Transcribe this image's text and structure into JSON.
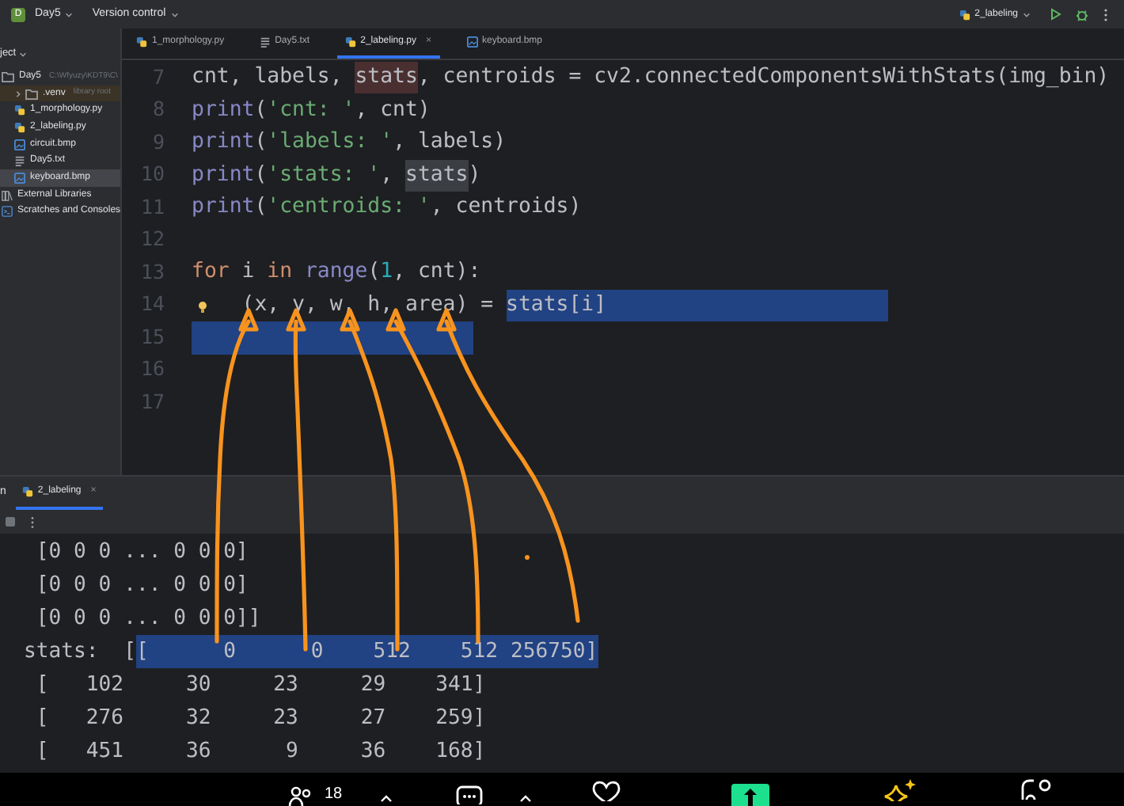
{
  "title_bar": {
    "project_badge": "D",
    "project": "Day5",
    "vcs": "Version control",
    "run_config": "2_labeling"
  },
  "project_panel": {
    "header": "ject",
    "items": [
      {
        "label": "Day5",
        "hint": "C:\\Wfyuzy\\KDT9\\C\\",
        "kind": "folder",
        "expanded": true,
        "excluded": false,
        "selected": false,
        "children": [
          {
            "label": ".venv",
            "hint": "library root",
            "kind": "folder",
            "expanded": false,
            "excluded": true,
            "selected": false
          },
          {
            "label": "1_morphology.py",
            "kind": "python",
            "excluded": false,
            "selected": false
          },
          {
            "label": "2_labeling.py",
            "kind": "python",
            "excluded": false,
            "selected": false
          },
          {
            "label": "circuit.bmp",
            "kind": "image",
            "excluded": false,
            "selected": false
          },
          {
            "label": "Day5.txt",
            "kind": "text",
            "excluded": false,
            "selected": false
          },
          {
            "label": "keyboard.bmp",
            "kind": "image",
            "excluded": false,
            "selected": true
          }
        ]
      },
      {
        "label": "External Libraries",
        "kind": "library",
        "excluded": false,
        "selected": false
      },
      {
        "label": "Scratches and Consoles",
        "kind": "scratches",
        "excluded": false,
        "selected": false
      }
    ]
  },
  "editor_tabs": [
    {
      "label": "1_morphology.py",
      "kind": "python",
      "selected": false
    },
    {
      "label": "Day5.txt",
      "kind": "text",
      "selected": false
    },
    {
      "label": "2_labeling.py",
      "kind": "python",
      "selected": true,
      "close": "×"
    },
    {
      "label": "keyboard.bmp",
      "kind": "image",
      "selected": false
    }
  ],
  "code_lines": [
    {
      "number": "7",
      "bulb": false,
      "selected": false,
      "tokens": [
        {
          "text": "cnt, labels, ",
          "kind": "plain"
        },
        {
          "text": "stats",
          "kind": "assignment"
        },
        {
          "text": ", centroids = cv2.connectedComponentsWithStats(img_bin)",
          "kind": "plain"
        }
      ]
    },
    {
      "number": "8",
      "bulb": false,
      "selected": false,
      "tokens": [
        {
          "text": "print",
          "kind": "builtin"
        },
        {
          "text": "(",
          "kind": "plain"
        },
        {
          "text": "'cnt: '",
          "kind": "string"
        },
        {
          "text": ", cnt)",
          "kind": "plain"
        }
      ]
    },
    {
      "number": "9",
      "bulb": false,
      "selected": false,
      "tokens": [
        {
          "text": "print",
          "kind": "builtin"
        },
        {
          "text": "(",
          "kind": "plain"
        },
        {
          "text": "'labels: '",
          "kind": "string"
        },
        {
          "text": ", labels)",
          "kind": "plain"
        }
      ]
    },
    {
      "number": "10",
      "bulb": false,
      "selected": false,
      "tokens": [
        {
          "text": "print",
          "kind": "builtin"
        },
        {
          "text": "(",
          "kind": "plain"
        },
        {
          "text": "'stats: '",
          "kind": "string"
        },
        {
          "text": ", ",
          "kind": "plain"
        },
        {
          "text": "stats",
          "kind": "usage"
        },
        {
          "text": ")",
          "kind": "plain"
        }
      ]
    },
    {
      "number": "11",
      "bulb": false,
      "selected": false,
      "tokens": [
        {
          "text": "print",
          "kind": "builtin"
        },
        {
          "text": "(",
          "kind": "plain"
        },
        {
          "text": "'centroids: '",
          "kind": "string"
        },
        {
          "text": ", centroids)",
          "kind": "plain"
        }
      ]
    },
    {
      "number": "12",
      "bulb": false,
      "selected": false
    },
    {
      "number": "13",
      "bulb": false,
      "selected": false,
      "tokens": [
        {
          "text": "for",
          "kind": "keyword"
        },
        {
          "text": " i ",
          "kind": "plain"
        },
        {
          "text": "in",
          "kind": "keyword"
        },
        {
          "text": " range",
          "kind": "builtin"
        },
        {
          "text": "(",
          "kind": "plain"
        },
        {
          "text": "1",
          "kind": "number"
        },
        {
          "text": ", cnt):",
          "kind": "plain"
        }
      ]
    },
    {
      "number": "14",
      "bulb": true,
      "selected": true,
      "tokens": [
        {
          "text": "    (x, y, w, h, area) = ",
          "kind": "plain"
        },
        {
          "text": "stats[i]",
          "kind": "selection"
        }
      ]
    },
    {
      "number": "15",
      "bulb": false,
      "selected": true
    },
    {
      "number": "16",
      "bulb": false,
      "selected": false
    },
    {
      "number": "17",
      "bulb": false,
      "selected": false
    }
  ],
  "run_panel": {
    "title": "n",
    "tab": {
      "label": "2_labeling",
      "close": "×",
      "selected": true
    },
    "console_lines": [
      [
        {
          "text": " [0 0 0 ... 0 0 0]",
          "selected": false
        }
      ],
      [
        {
          "text": " [0 0 0 ... 0 0 0]",
          "selected": false
        }
      ],
      [
        {
          "text": " [0 0 0 ... 0 0 0]]",
          "selected": false
        }
      ],
      [
        {
          "text": "stats:  [",
          "selected": false
        },
        {
          "text": "[      0      0    512    512 256750]",
          "selected": true
        }
      ],
      [
        {
          "text": " [   102     30     23     29    341]",
          "selected": false
        }
      ],
      [
        {
          "text": " [   276     32     23     27    259]",
          "selected": false
        }
      ],
      [
        {
          "text": " [   451     36      9     36    168]",
          "selected": false
        }
      ]
    ]
  },
  "annotations": [
    {
      "kind": "arrow"
    },
    {
      "kind": "arrow"
    },
    {
      "kind": "arrow"
    },
    {
      "kind": "arrow"
    },
    {
      "kind": "arrow"
    },
    {
      "kind": "dot"
    }
  ],
  "taskbar": {
    "participants": "18"
  }
}
